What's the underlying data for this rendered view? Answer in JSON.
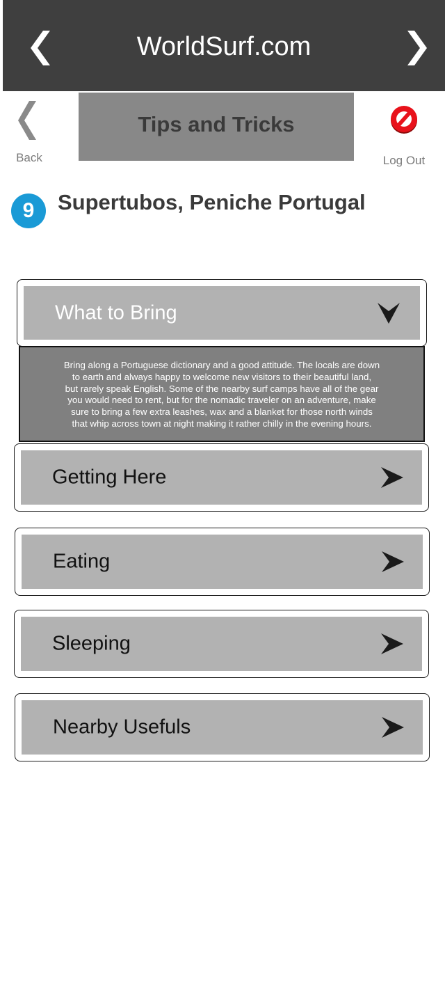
{
  "header": {
    "title": "WorldSurf.com",
    "left_arrow_icon": "chevron-left-icon",
    "right_arrow_icon": "chevron-right-icon"
  },
  "subheader": {
    "back_label": "Back",
    "section_title": "Tips and Tricks",
    "logout_label": "Log Out",
    "logout_icon": "prohibited-icon"
  },
  "spot": {
    "number": "9",
    "name": "Supertubos, Peniche Portugal",
    "badge_color": "#1a9ad6"
  },
  "accordion": [
    {
      "label": "What to Bring",
      "state": "expanded",
      "icon": "chevron-down-icon",
      "body_lines": [
        "Bring along a Portuguese dictionary and a good attitude. The locals are down",
        "to earth and always happy to welcome new visitors to their beautiful land,",
        "but rarely speak English. Some of the nearby surf camps have all of the gear",
        "you would need to rent, but for the nomadic traveler on an adventure,  make",
        "sure to bring a few extra leashes, wax and a blanket for those north winds",
        "that whip across town at night making it rather chilly in the evening hours."
      ]
    },
    {
      "label": "Getting Here",
      "state": "collapsed",
      "icon": "arrow-right-icon"
    },
    {
      "label": "Eating",
      "state": "collapsed",
      "icon": "arrow-right-icon"
    },
    {
      "label": "Sleeping",
      "state": "collapsed",
      "icon": "arrow-right-icon"
    },
    {
      "label": "Nearby Usefuls",
      "state": "collapsed",
      "icon": "arrow-right-icon"
    }
  ]
}
